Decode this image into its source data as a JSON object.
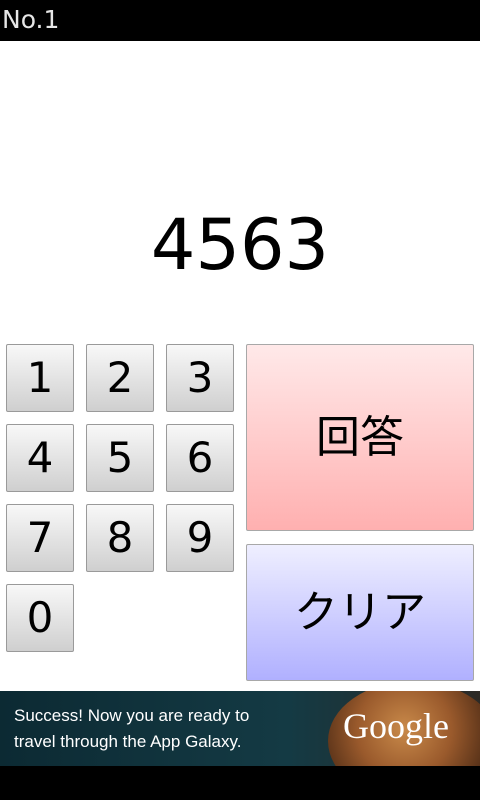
{
  "titlebar": {
    "title": "No.1"
  },
  "display": {
    "value": "4563"
  },
  "keypad": {
    "keys": [
      "1",
      "2",
      "3",
      "4",
      "5",
      "6",
      "7",
      "8",
      "9",
      "0"
    ]
  },
  "actions": {
    "answer_label": "回答",
    "clear_label": "クリア"
  },
  "ad": {
    "line1": "Success! Now you are ready to",
    "line2": "travel through the App Galaxy.",
    "brand": "Google"
  },
  "colors": {
    "answer_bg": "#ffb0b0",
    "clear_bg": "#b0b0ff",
    "titlebar_bg": "#000000"
  }
}
